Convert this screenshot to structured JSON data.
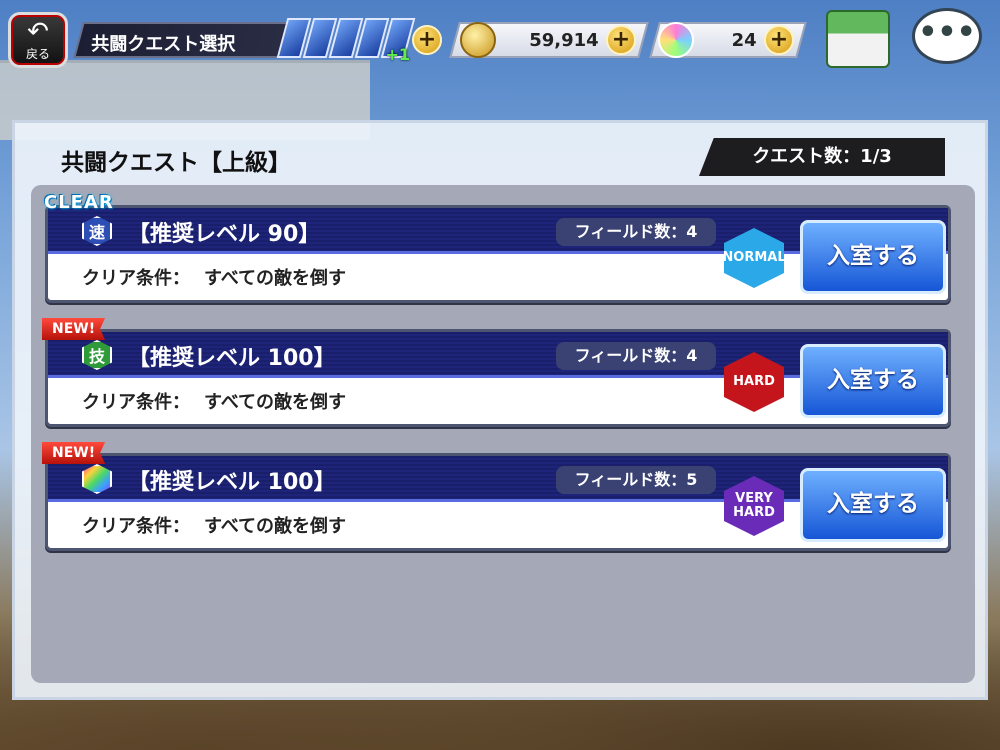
{
  "header": {
    "back_label": "戻る",
    "title": "共闘クエスト選択",
    "stamina_bonus": "+1",
    "coins": "59,914",
    "gems": "24",
    "plus_symbol": "+",
    "chat_symbol": "•••"
  },
  "panel": {
    "title": "共闘クエスト【上級】",
    "quest_count": "クエスト数：1/3"
  },
  "quests": [
    {
      "ribbon": "CLEAR",
      "type_icon": "速",
      "type_color": "#2d4fb5",
      "level": "【推奨レベル 90】",
      "fields": "フィールド数：4",
      "condition_label": "クリア条件：",
      "condition": "すべての敵を倒す",
      "difficulty": "NORMAL",
      "difficulty_color": "#2aa8e8",
      "enter_label": "入室する"
    },
    {
      "ribbon": "NEW!",
      "type_icon": "技",
      "type_color": "#2f9a3a",
      "level": "【推奨レベル 100】",
      "fields": "フィールド数：4",
      "condition_label": "クリア条件：",
      "condition": "すべての敵を倒す",
      "difficulty": "HARD",
      "difficulty_color": "#c4151c",
      "enter_label": "入室する"
    },
    {
      "ribbon": "NEW!",
      "type_icon": "",
      "type_color": "#e94fa0",
      "level": "【推奨レベル 100】",
      "fields": "フィールド数：5",
      "condition_label": "クリア条件：",
      "condition": "すべての敵を倒す",
      "difficulty": "VERY HARD",
      "difficulty_color": "#6a2bb8",
      "enter_label": "入室する"
    }
  ]
}
